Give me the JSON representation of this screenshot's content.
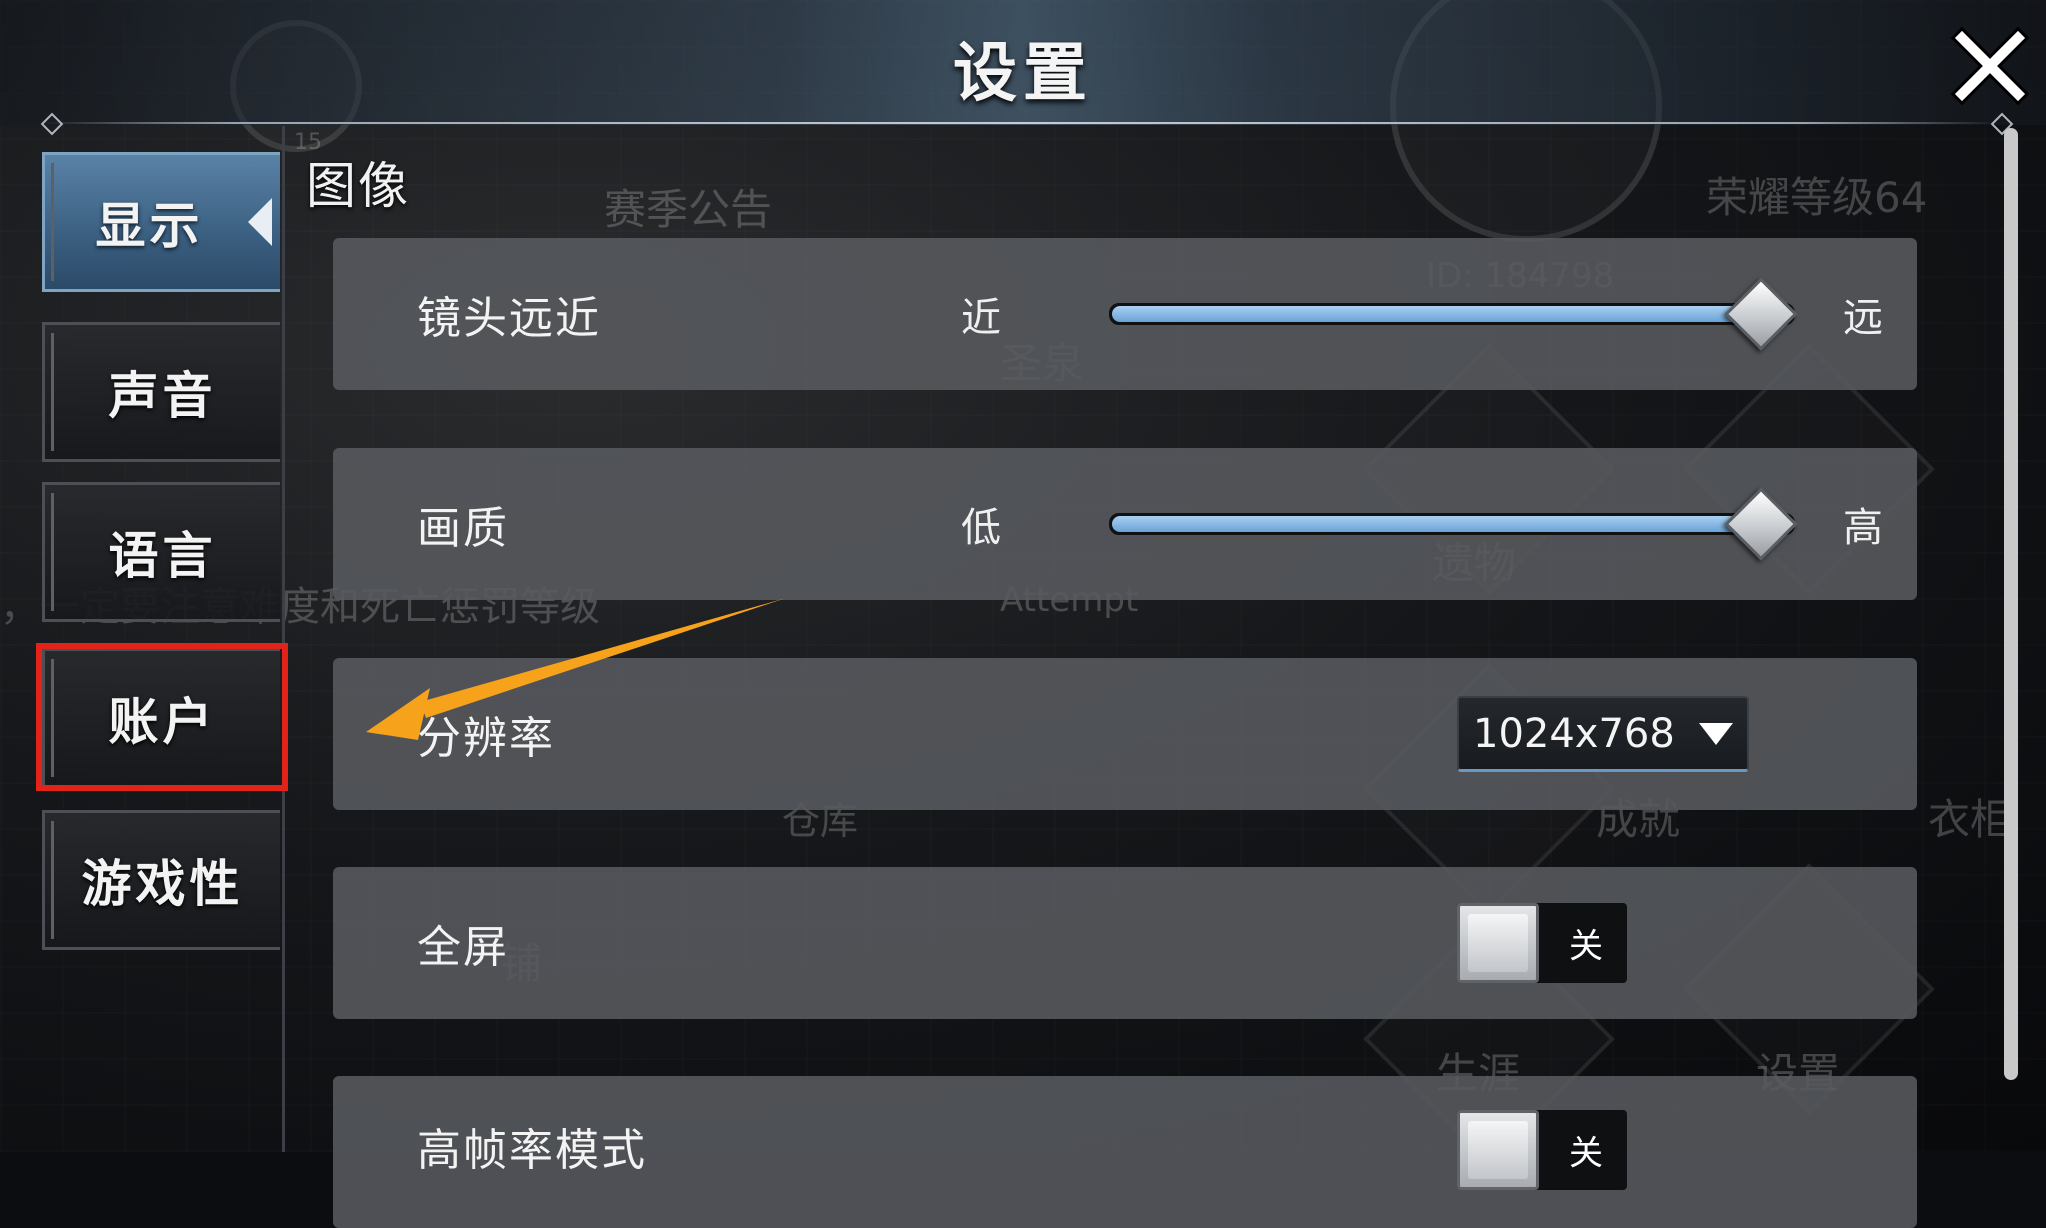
{
  "header": {
    "title": "设置",
    "close_icon": "close-icon"
  },
  "sidebar": {
    "tabs": [
      {
        "label": "显示",
        "active": true
      },
      {
        "label": "声音",
        "active": false
      },
      {
        "label": "语言",
        "active": false
      },
      {
        "label": "账户",
        "active": false,
        "highlighted": true
      },
      {
        "label": "游戏性",
        "active": false
      }
    ]
  },
  "content": {
    "section_title": "图像",
    "rows": [
      {
        "type": "slider",
        "label": "镜头远近",
        "min_label": "近",
        "max_label": "远",
        "value_fraction": 1.0
      },
      {
        "type": "slider",
        "label": "画质",
        "min_label": "低",
        "max_label": "高",
        "value_fraction": 1.0
      },
      {
        "type": "dropdown",
        "label": "分辨率",
        "value": "1024x768"
      },
      {
        "type": "toggle",
        "label": "全屏",
        "state": "关"
      },
      {
        "type": "toggle",
        "label": "高帧率模式",
        "state": "关"
      }
    ]
  },
  "background_text": {
    "season_notice": "赛季公告",
    "glory_level": "荣耀等级64",
    "player_id": "ID: 184798",
    "sacred_spring": "圣泉",
    "relics": "遗物",
    "warning_tip": "，一定要注意难度和死亡惩罚等级",
    "attempt": "Attempt",
    "warehouse": "仓库",
    "achievements": "成就",
    "career": "生涯",
    "settings": "设置",
    "wardrobe": "衣柜",
    "shop": "铺",
    "level_badge": "15"
  },
  "colors": {
    "accent_blue": "#3d6284",
    "slider_fill": "#8bbde6",
    "highlight_red": "#e2231a",
    "annotation_arrow": "#f7a21b",
    "row_bg": "#58595e"
  }
}
